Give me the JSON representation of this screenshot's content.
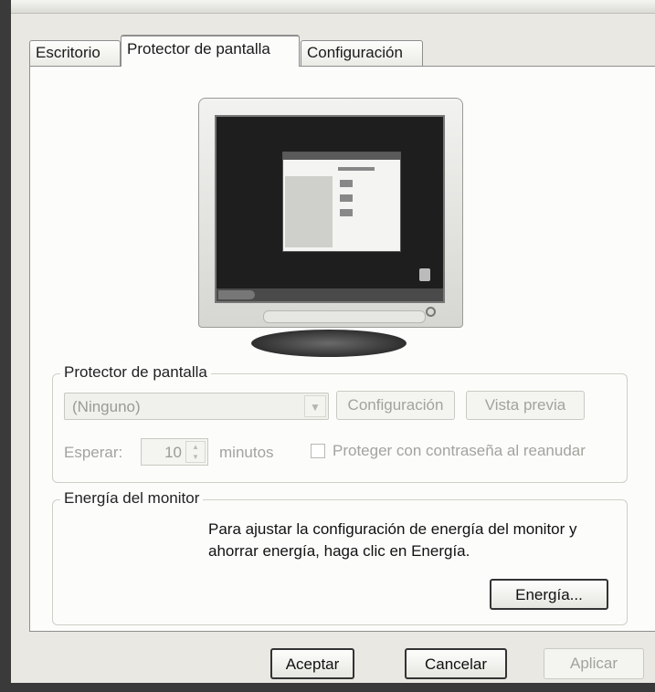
{
  "tabs": [
    {
      "label": "Escritorio"
    },
    {
      "label": "Protector de pantalla"
    },
    {
      "label": "Configuración"
    }
  ],
  "active_tab_index": 1,
  "screensaver_group": {
    "title": "Protector de pantalla",
    "select_value": "(Ninguno)",
    "config_button": "Configuración",
    "preview_button": "Vista previa",
    "wait_label": "Esperar:",
    "wait_value": "10",
    "minutes_label": "minutos",
    "password_label": "Proteger con contraseña al reanudar",
    "password_checked": false
  },
  "energy_group": {
    "title": "Energía del monitor",
    "description": "Para ajustar la configuración de energía del monitor y ahorrar energía, haga clic en Energía.",
    "energy_button": "Energía..."
  },
  "footer": {
    "ok": "Aceptar",
    "cancel": "Cancelar",
    "apply": "Aplicar"
  },
  "icons": {
    "preview": "monitor-icon",
    "dropdown": "chevron-down-icon",
    "spinner": "spinner-arrows-icon"
  }
}
